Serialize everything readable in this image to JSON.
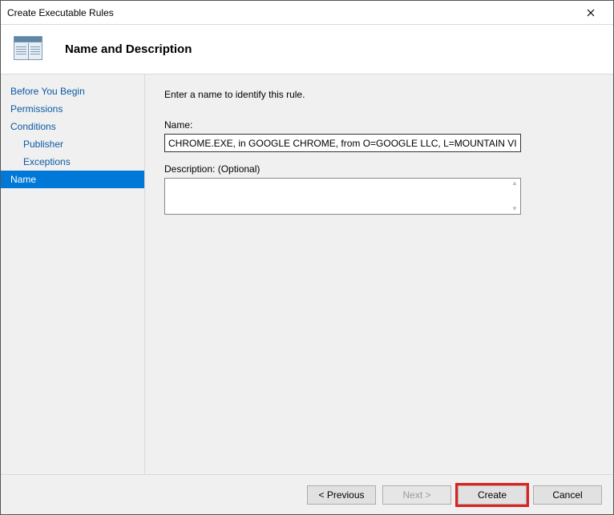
{
  "window": {
    "title": "Create Executable Rules"
  },
  "header": {
    "title": "Name and Description"
  },
  "sidebar": {
    "items": [
      {
        "label": "Before You Begin",
        "sub": false,
        "selected": false
      },
      {
        "label": "Permissions",
        "sub": false,
        "selected": false
      },
      {
        "label": "Conditions",
        "sub": false,
        "selected": false
      },
      {
        "label": "Publisher",
        "sub": true,
        "selected": false
      },
      {
        "label": "Exceptions",
        "sub": true,
        "selected": false
      },
      {
        "label": "Name",
        "sub": false,
        "selected": true
      }
    ]
  },
  "main": {
    "intro": "Enter a name to identify this rule.",
    "name_label": "Name:",
    "name_value": "CHROME.EXE, in GOOGLE CHROME, from O=GOOGLE LLC, L=MOUNTAIN VIEW, S=",
    "description_label": "Description: (Optional)",
    "description_value": ""
  },
  "footer": {
    "previous": "< Previous",
    "next": "Next >",
    "create": "Create",
    "cancel": "Cancel"
  }
}
